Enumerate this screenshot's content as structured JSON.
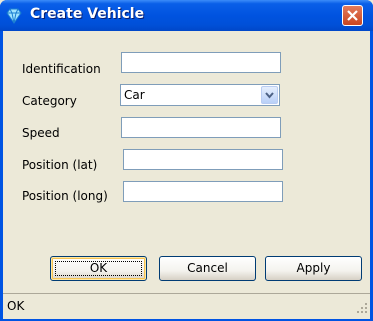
{
  "window": {
    "title": "Create Vehicle"
  },
  "form": {
    "identification": {
      "label": "Identification",
      "value": ""
    },
    "category": {
      "label": "Category",
      "value": "Car"
    },
    "speed": {
      "label": "Speed",
      "value": ""
    },
    "position_lat": {
      "label": "Position (lat)",
      "value": ""
    },
    "position_long": {
      "label": "Position (long)",
      "value": ""
    }
  },
  "buttons": {
    "ok": "OK",
    "cancel": "Cancel",
    "apply": "Apply"
  },
  "status": {
    "text": "OK"
  },
  "colors": {
    "titlebar": "#0053E0",
    "close": "#C94520",
    "dialog_bg": "#ECE9D8",
    "field_border": "#7F9DB9"
  },
  "icons": {
    "app": "diamond-icon",
    "close": "close-icon",
    "dropdown": "chevron-down-icon",
    "grip": "resize-grip-icon"
  }
}
